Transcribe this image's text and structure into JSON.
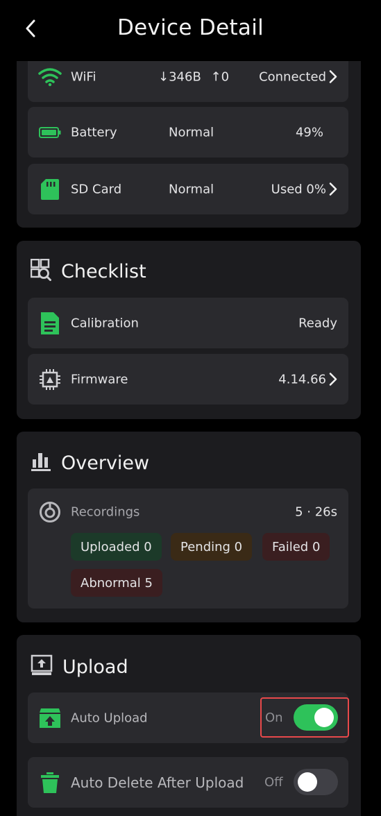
{
  "header": {
    "title": "Device Detail"
  },
  "connectivity": {
    "wifi": {
      "label": "WiFi",
      "down": "346B",
      "up": "0",
      "status": "Connected"
    },
    "battery": {
      "label": "Battery",
      "status": "Normal",
      "value": "49%"
    },
    "sd_card": {
      "label": "SD Card",
      "status": "Normal",
      "value": "Used 0%"
    }
  },
  "checklist": {
    "title": "Checklist",
    "calibration": {
      "label": "Calibration",
      "value": "Ready"
    },
    "firmware": {
      "label": "Firmware",
      "value": "4.14.66"
    }
  },
  "overview": {
    "title": "Overview",
    "recordings": {
      "label": "Recordings",
      "value": "5 · 26s"
    },
    "badges": {
      "uploaded": "Uploaded 0",
      "pending": "Pending 0",
      "failed": "Failed 0",
      "abnormal": "Abnormal 5"
    }
  },
  "upload": {
    "title": "Upload",
    "auto_upload": {
      "label": "Auto Upload",
      "state": "On"
    },
    "auto_delete": {
      "label": "Auto Delete After Upload",
      "state": "Off"
    }
  },
  "colors": {
    "accent": "#2ec25a",
    "highlight": "#e8494b",
    "card": "#1c1c1f",
    "row": "#2a2a2e"
  }
}
